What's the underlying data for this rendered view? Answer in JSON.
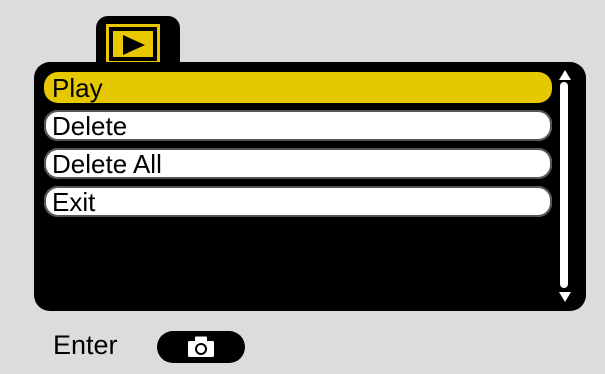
{
  "mode_tab": {
    "icon": "play-icon",
    "accent": "#e8c800"
  },
  "menu": {
    "items": [
      {
        "label": "Play",
        "selected": true
      },
      {
        "label": "Delete",
        "selected": false
      },
      {
        "label": "Delete All",
        "selected": false
      },
      {
        "label": "Exit",
        "selected": false
      }
    ],
    "highlight_color": "#e6c800"
  },
  "footer": {
    "enter_label": "Enter",
    "button_icon": "camera-icon"
  }
}
